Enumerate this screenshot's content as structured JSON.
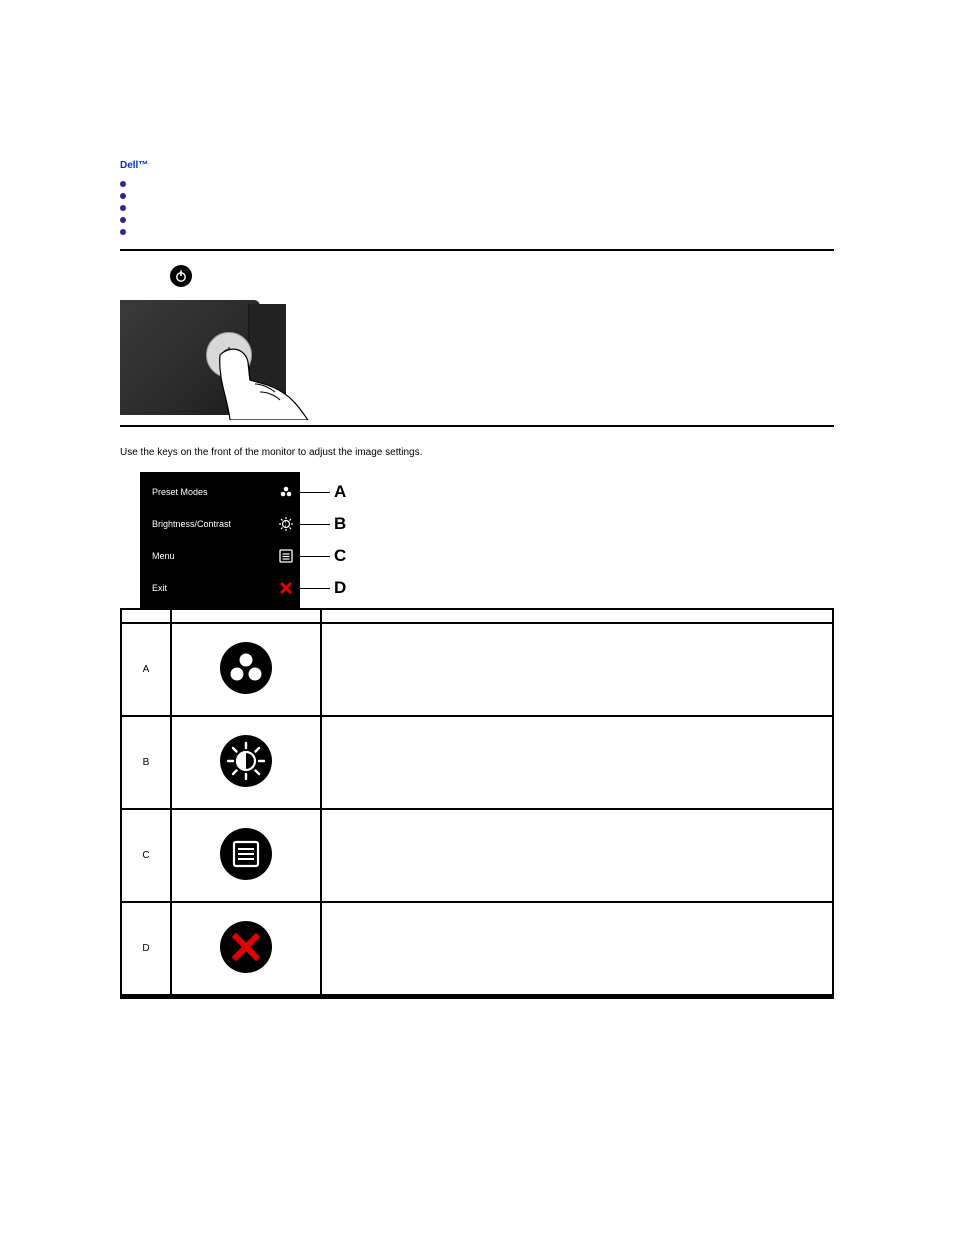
{
  "topLink": " ",
  "brand": "Dell™",
  "toc": {
    "items": [
      {
        "label": " "
      },
      {
        "label": " "
      },
      {
        "label": " "
      },
      {
        "label": " "
      },
      {
        "label": " "
      }
    ]
  },
  "bodyText": "Use the keys on the front of the monitor to adjust the image settings.",
  "osd": {
    "rows": [
      {
        "label": "Preset Modes",
        "icon": "preset-modes-icon",
        "letter": "A"
      },
      {
        "label": "Brightness/Contrast",
        "icon": "brightness-icon",
        "letter": "B"
      },
      {
        "label": "Menu",
        "icon": "menu-icon",
        "letter": "C"
      },
      {
        "label": "Exit",
        "icon": "exit-icon",
        "letter": "D"
      }
    ]
  },
  "table": {
    "headers": {
      "col1": "",
      "col2": "",
      "col3": ""
    },
    "rows": [
      {
        "letter": "A",
        "icon": "preset-modes-icon",
        "desc": "",
        "link": " "
      },
      {
        "letter": "B",
        "icon": "brightness-icon",
        "desc": ""
      },
      {
        "letter": "C",
        "icon": "menu-icon",
        "desc": ""
      },
      {
        "letter": "D",
        "icon": "exit-icon",
        "desc": ""
      }
    ]
  }
}
